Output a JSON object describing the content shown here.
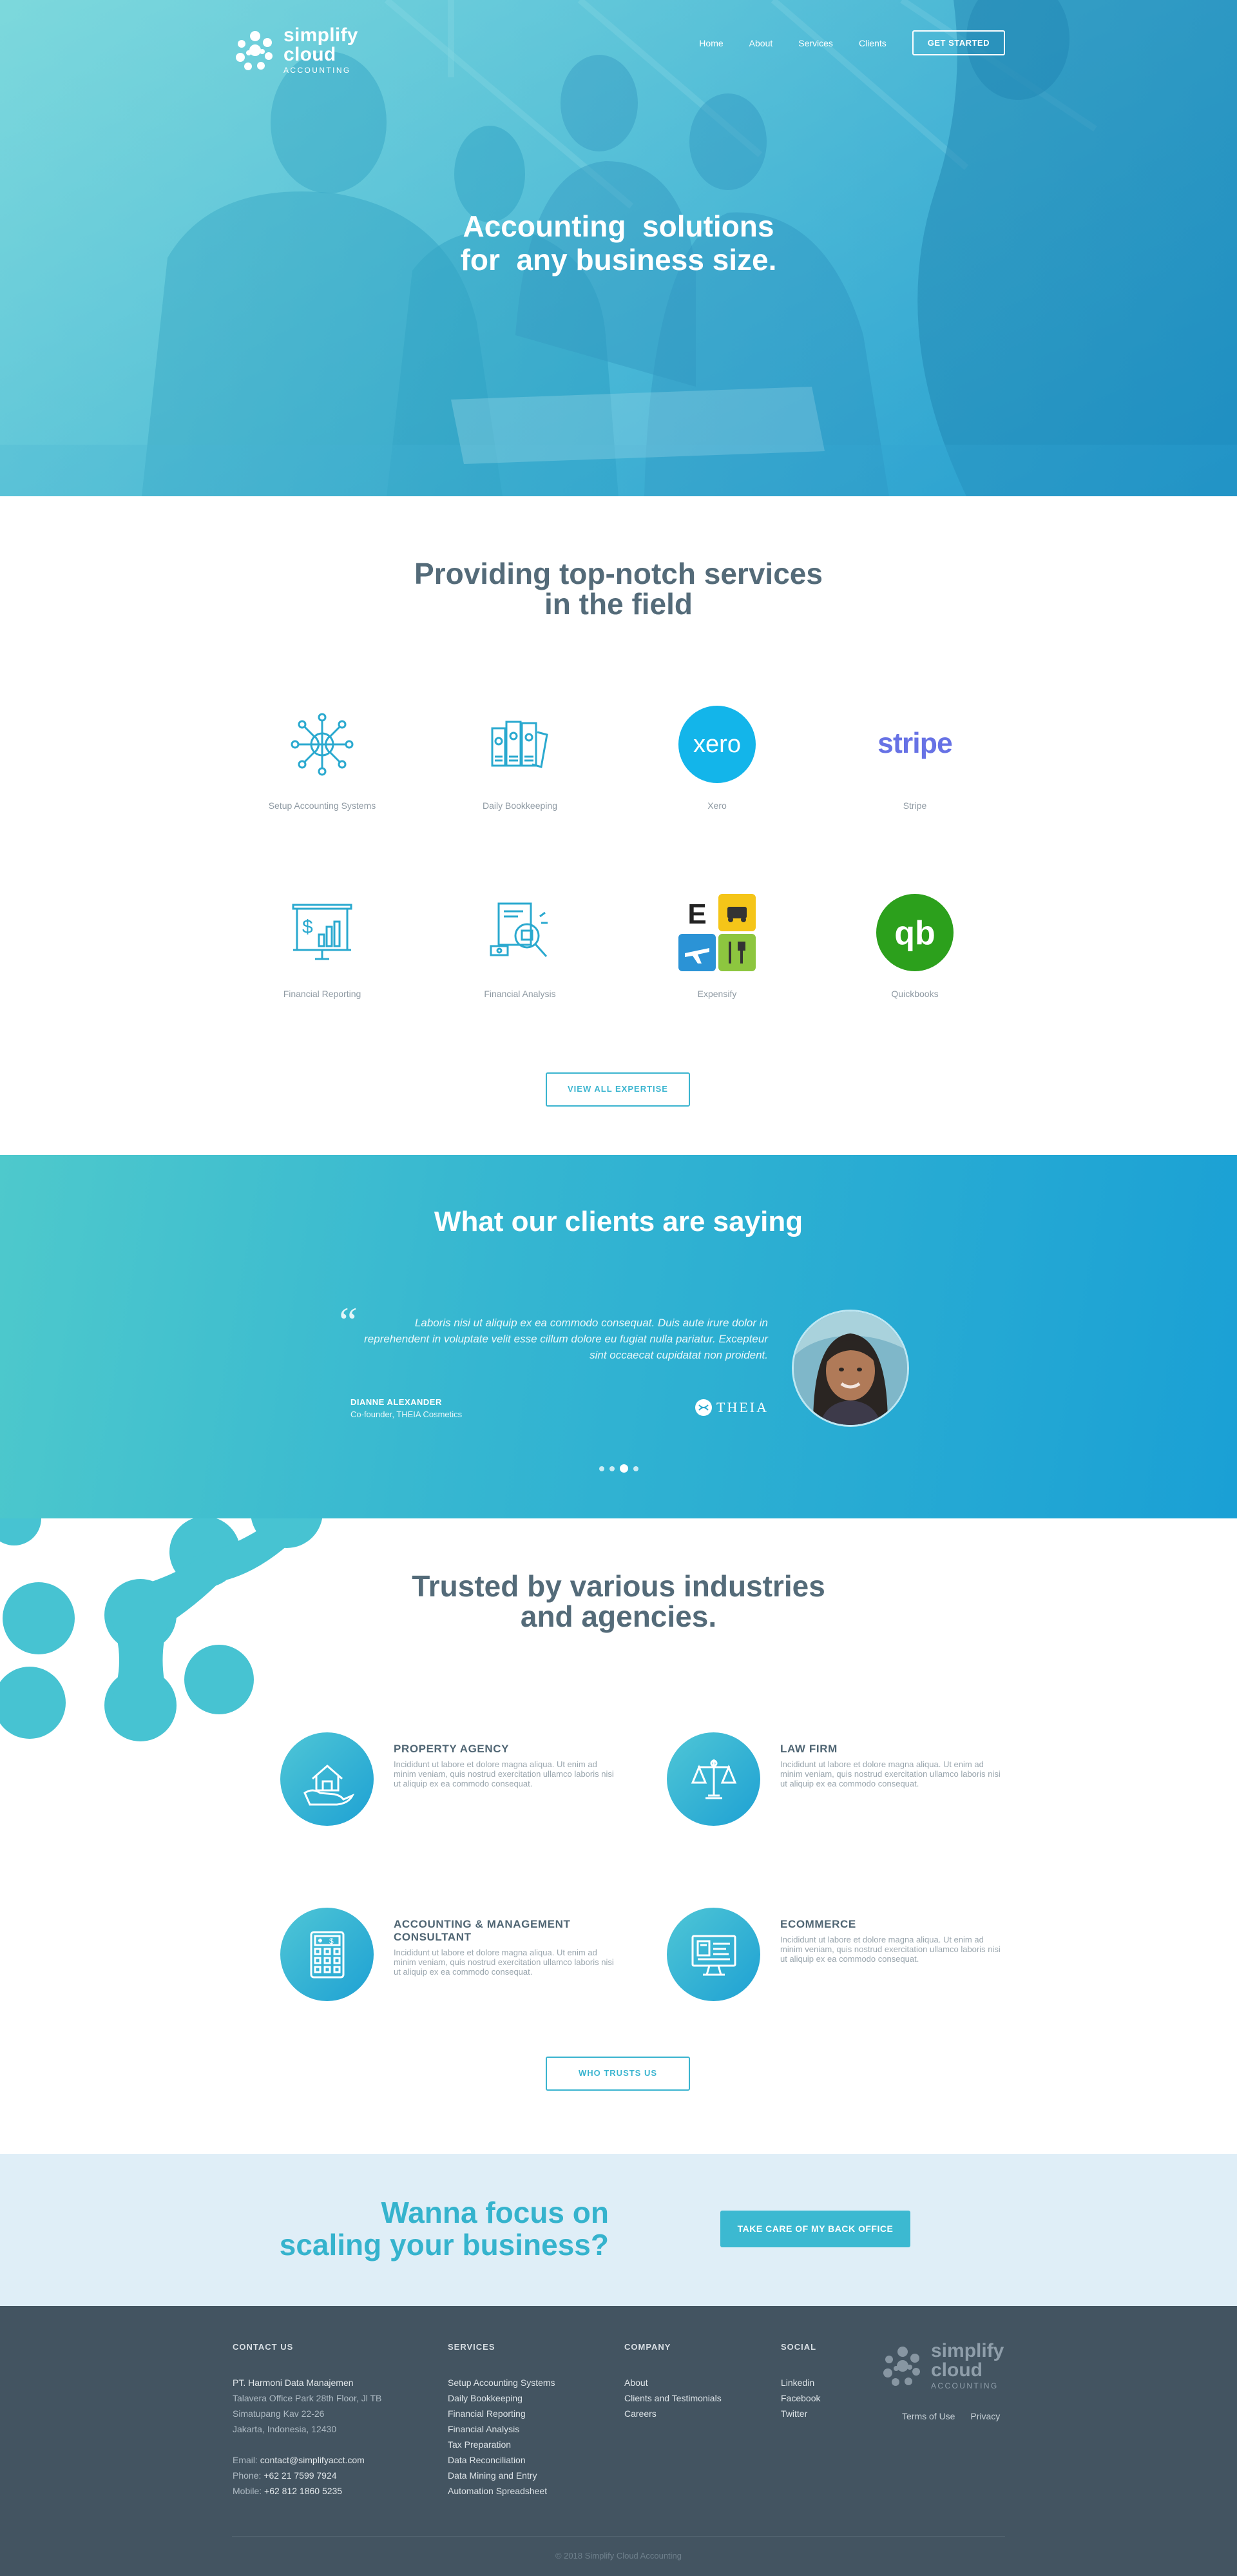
{
  "brand": {
    "name_line1": "simplify",
    "name_line2": "cloud",
    "tagline": "ACCOUNTING",
    "colors": {
      "primary": "#3ab4cf",
      "dark": "#435461",
      "heading": "#546b79"
    }
  },
  "nav": {
    "items": [
      "Home",
      "About",
      "Services",
      "Clients"
    ],
    "cta": "GET STARTED"
  },
  "hero": {
    "title_line1": "Accounting  solutions",
    "title_line2": "for  any business size."
  },
  "services": {
    "title_line1": "Providing top-notch services",
    "title_line2": "in the field",
    "items": [
      {
        "label": "Setup Accounting Systems",
        "icon": "network-globe-icon"
      },
      {
        "label": "Daily Bookkeeping",
        "icon": "binders-icon"
      },
      {
        "label": "Xero",
        "icon": "xero-logo",
        "logo_text": "xero"
      },
      {
        "label": "Stripe",
        "icon": "stripe-logo",
        "logo_text": "stripe"
      },
      {
        "label": "Financial Reporting",
        "icon": "report-board-icon"
      },
      {
        "label": "Financial Analysis",
        "icon": "document-magnifier-icon"
      },
      {
        "label": "Expensify",
        "icon": "expensify-logo",
        "logo_text": "E"
      },
      {
        "label": "Quickbooks",
        "icon": "quickbooks-logo",
        "logo_text": "qb"
      }
    ],
    "button": "VIEW ALL EXPERTISE"
  },
  "testimonials": {
    "title": "What our clients are saying",
    "quote": "Laboris nisi ut aliquip ex ea commodo consequat. Duis aute irure dolor in reprehendent in voluptate velit esse cillum dolore eu fugiat nulla pariatur. Excepteur sint occaecat cupidatat non proident.",
    "name": "DIANNE ALEXANDER",
    "role": "Co-founder, THEIA Cosmetics",
    "company": "THEIA",
    "active_slide": 3,
    "slide_count": 4
  },
  "industries": {
    "title_line1": "Trusted by various industries",
    "title_line2": "and agencies.",
    "items": [
      {
        "title": "PROPERTY AGENCY",
        "icon": "house-hand-icon",
        "desc": "Incididunt ut labore et dolore magna aliqua. Ut enim ad minim veniam, quis nostrud exercitation ullamco laboris nisi ut aliquip ex ea commodo consequat."
      },
      {
        "title": "LAW FIRM",
        "icon": "scales-icon",
        "desc": "Incididunt ut labore et dolore magna aliqua. Ut enim ad minim veniam, quis nostrud exercitation ullamco laboris nisi ut aliquip ex ea commodo consequat."
      },
      {
        "title": "ACCOUNTING & MANAGEMENT CONSULTANT",
        "icon": "calculator-icon",
        "desc": "Incididunt ut labore et dolore magna aliqua. Ut enim ad minim veniam, quis nostrud exercitation ullamco laboris nisi ut aliquip ex ea commodo consequat."
      },
      {
        "title": "ECOMMERCE",
        "icon": "monitor-shop-icon",
        "desc": "Incididunt ut labore et dolore magna aliqua. Ut enim ad minim veniam, quis nostrud exercitation ullamco laboris nisi ut aliquip ex ea commodo consequat."
      }
    ],
    "button": "WHO TRUSTS US"
  },
  "cta": {
    "line1": "Wanna focus on",
    "line2": "scaling your business?",
    "button": "TAKE CARE OF MY BACK OFFICE"
  },
  "footer": {
    "contact": {
      "heading": "CONTACT US",
      "company": "PT. Harmoni Data Manajemen",
      "address": [
        "Talavera Office Park 28th Floor, Jl TB",
        "Simatupang Kav 22-26",
        "Jakarta, Indonesia, 12430"
      ],
      "email_label": "Email:",
      "email": "contact@simplifyacct.com",
      "phone_label": "Phone:",
      "phone": "+62 21 7599 7924",
      "mobile_label": "Mobile:",
      "mobile": "+62 812 1860 5235"
    },
    "services": {
      "heading": "SERVICES",
      "links": [
        "Setup Accounting Systems",
        "Daily Bookkeeping",
        "Financial Reporting",
        "Financial Analysis",
        "Tax Preparation",
        "Data Reconciliation",
        "Data Mining and Entry",
        "Automation Spreadsheet"
      ]
    },
    "company": {
      "heading": "COMPANY",
      "links": [
        "About",
        "Clients and Testimonials",
        "Careers"
      ]
    },
    "social": {
      "heading": "SOCIAL",
      "links": [
        "Linkedin",
        "Facebook",
        "Twitter"
      ]
    },
    "legal": [
      "Terms of Use",
      "Privacy"
    ],
    "copyright": "© 2018 Simplify Cloud Accounting"
  }
}
